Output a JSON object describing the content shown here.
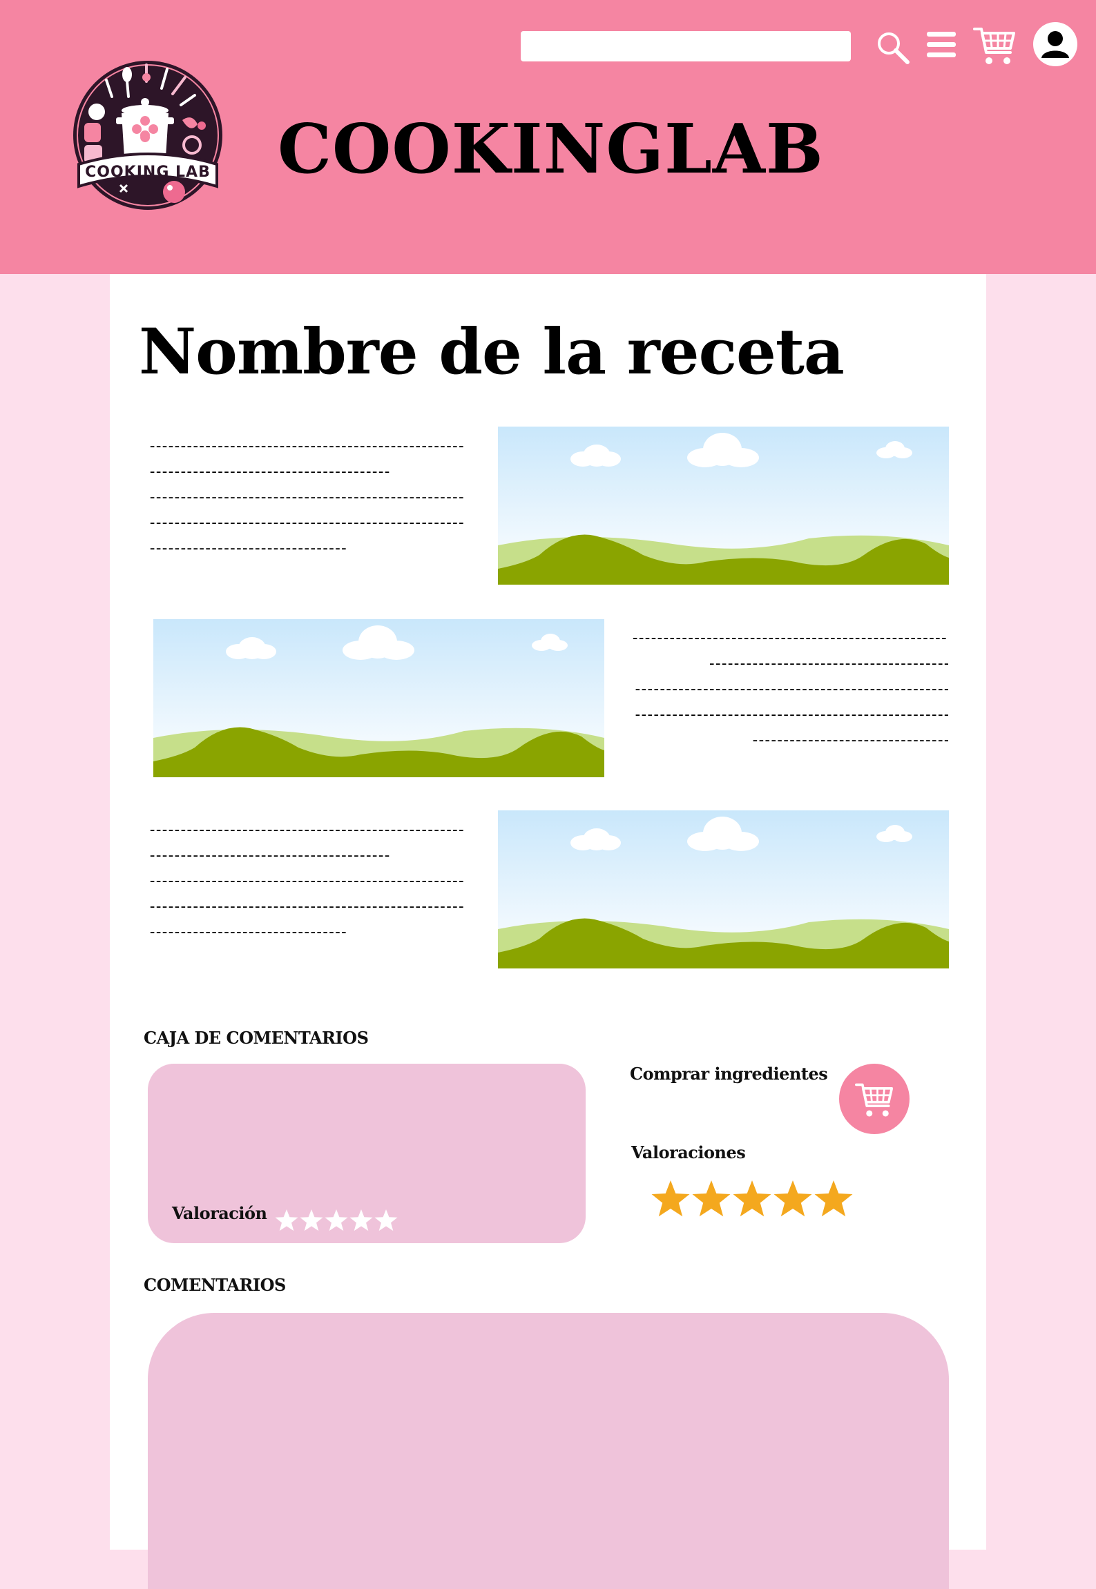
{
  "header": {
    "brand": "COOKINGLAB",
    "logo_text": "COOKING LAB",
    "search": {
      "value": "",
      "placeholder": ""
    },
    "icons": [
      "search-icon",
      "menu-icon",
      "cart-icon",
      "user-icon"
    ]
  },
  "recipe": {
    "title": "Nombre de la receta",
    "sections": [
      {
        "lines": [
          "---------------------------------------------------------",
          "---------------------------------------",
          "---------------------------------------------------",
          "---------------------------------------------------",
          "--------------------------------"
        ]
      },
      {
        "lines": [
          "---------------------------------------------------------",
          "---------------------------------------",
          "---------------------------------------------------",
          "---------------------------------------------------",
          "--------------------------------"
        ]
      },
      {
        "lines": [
          "---------------------------------------------------------",
          "---------------------------------------",
          "---------------------------------------------------",
          "---------------------------------------------------",
          "--------------------------------"
        ]
      }
    ]
  },
  "comment_box": {
    "heading": "CAJA DE COMENTARIOS",
    "value": "",
    "rating_label": "Valoración",
    "rating_stars": 5
  },
  "sidebar": {
    "buy_label": "Comprar ingredientes",
    "ratings_label": "Valoraciones",
    "rating_value": 5
  },
  "comments": {
    "heading": "COMENTARIOS"
  },
  "colors": {
    "header": "#f585a2",
    "page_bg": "#fddfec",
    "panel": "#efc3da",
    "star_gold": "#f4a81e",
    "logo_dark": "#2d1528"
  }
}
